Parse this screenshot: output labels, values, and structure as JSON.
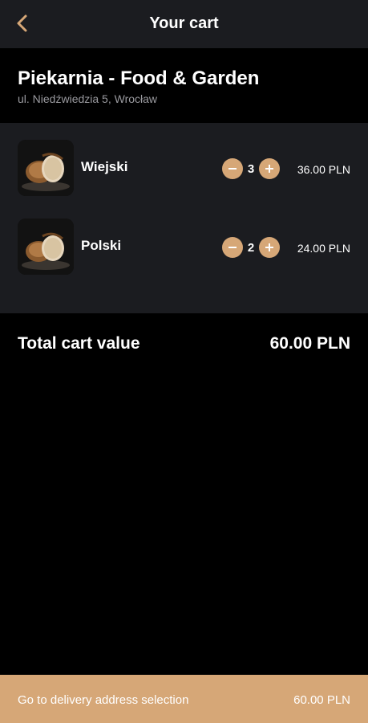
{
  "header": {
    "title": "Your cart",
    "back_icon": "chevron-left-icon",
    "accent_color": "#d6a777"
  },
  "shop": {
    "name": "Piekarnia - Food & Garden",
    "address": "ul. Niedźwiedzia 5, Wrocław"
  },
  "cart": {
    "items": [
      {
        "name": "Wiejski",
        "quantity": "3",
        "price": "36.00 PLN",
        "image": "bread-loaf-photo"
      },
      {
        "name": "Polski",
        "quantity": "2",
        "price": "24.00 PLN",
        "image": "bread-loaf-photo"
      }
    ]
  },
  "total": {
    "label": "Total cart value",
    "value": "60.00 PLN"
  },
  "footer": {
    "cta_label": "Go to delivery address selection",
    "cta_price": "60.00 PLN"
  }
}
